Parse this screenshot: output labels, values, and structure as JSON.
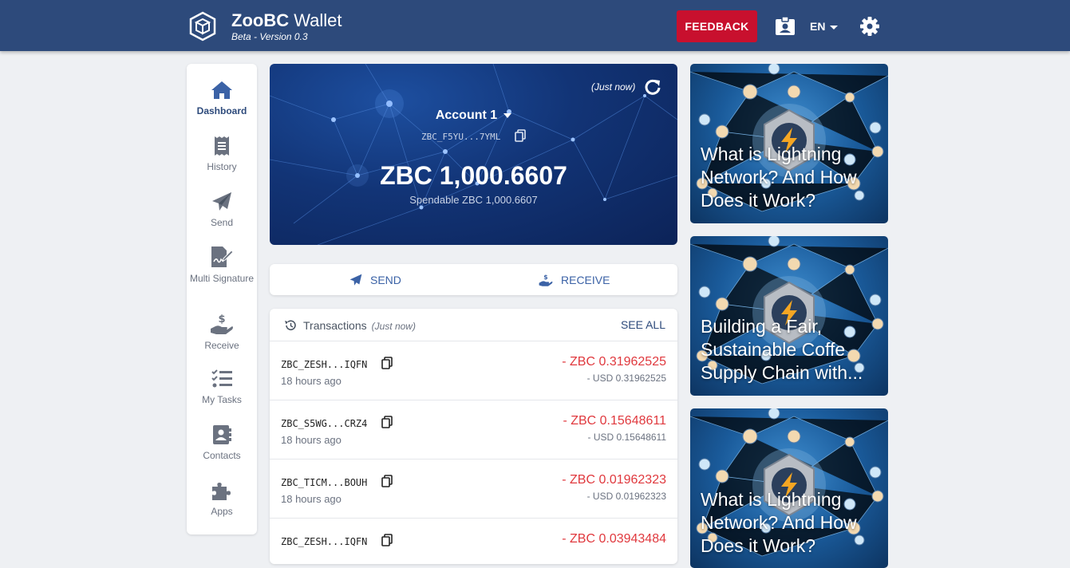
{
  "header": {
    "brand_bold": "ZooBC",
    "brand_rest": " Wallet",
    "subtitle": "Beta - Version 0.3",
    "feedback_label": "FEEDBACK",
    "language": "EN",
    "colors": {
      "header_bg": "#2d4a7b",
      "feedback_bg": "#c8102e"
    }
  },
  "sidebar": {
    "items": [
      {
        "label": "Dashboard",
        "icon": "home-icon",
        "active": true
      },
      {
        "label": "History",
        "icon": "receipt-icon"
      },
      {
        "label": "Send",
        "icon": "paper-plane-icon"
      },
      {
        "label": "Multi Signature",
        "icon": "signature-icon"
      },
      {
        "label": "Receive",
        "icon": "hand-dollar-icon"
      },
      {
        "label": "My Tasks",
        "icon": "tasks-icon"
      },
      {
        "label": "Contacts",
        "icon": "contacts-icon"
      },
      {
        "label": "Apps",
        "icon": "puzzle-icon"
      }
    ]
  },
  "balance_card": {
    "updated": "(Just now)",
    "account_name": "Account 1",
    "address": "ZBC_F5YU...7YML",
    "balance": "ZBC 1,000.6607",
    "spendable": "Spendable ZBC 1,000.6607"
  },
  "actions": {
    "send_label": "SEND",
    "receive_label": "RECEIVE"
  },
  "transactions": {
    "title": "Transactions",
    "updated": "(Just now)",
    "see_all": "SEE ALL",
    "rows": [
      {
        "address": "ZBC_ZESH...IQFN",
        "time": "18 hours ago",
        "amount": "- ZBC 0.31962525",
        "usd": "- USD 0.31962525"
      },
      {
        "address": "ZBC_S5WG...CRZ4",
        "time": "18 hours ago",
        "amount": "- ZBC 0.15648611",
        "usd": "- USD 0.15648611"
      },
      {
        "address": "ZBC_TICM...BOUH",
        "time": "18 hours ago",
        "amount": "- ZBC 0.01962323",
        "usd": "- USD 0.01962323"
      },
      {
        "address": "ZBC_ZESH...IQFN",
        "time": "",
        "amount": "- ZBC 0.03943484",
        "usd": ""
      }
    ]
  },
  "news": [
    {
      "title": "What is Lightning Network? And How Does it Work?"
    },
    {
      "title": "Building a Fair, Sustainable Coffe Supply Chain with..."
    },
    {
      "title": "What is Lightning Network? And How Does it Work?"
    }
  ]
}
